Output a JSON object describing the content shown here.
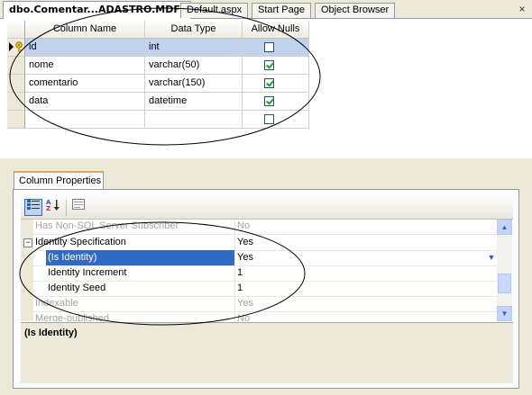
{
  "tabs": [
    {
      "label": "dbo.Comentar...ADASTRO.MDF)",
      "active": true
    },
    {
      "label": "Default.aspx",
      "active": false
    },
    {
      "label": "Start Page",
      "active": false
    },
    {
      "label": "Object Browser",
      "active": false
    }
  ],
  "close_icon": "×",
  "table": {
    "headers": [
      "Column Name",
      "Data Type",
      "Allow Nulls"
    ],
    "rows": [
      {
        "name": "id",
        "type": "int",
        "allow_nulls": false,
        "primary_key": true
      },
      {
        "name": "nome",
        "type": "varchar(50)",
        "allow_nulls": true
      },
      {
        "name": "comentario",
        "type": "varchar(150)",
        "allow_nulls": true
      },
      {
        "name": "data",
        "type": "datetime",
        "allow_nulls": true
      },
      {
        "name": "",
        "type": "",
        "allow_nulls": false
      }
    ]
  },
  "column_properties": {
    "tab_label": "Column Properties",
    "toolbar": {
      "categorized_icon": "categorized-icon",
      "alphabetical_icon": "alphabetical-icon",
      "property_pages_icon": "property-pages-icon"
    },
    "rows": [
      {
        "name": "Has Non-SQL Server Subscriber",
        "value": "No",
        "disabled": true
      },
      {
        "name": "Identity Specification",
        "value": "Yes",
        "expander": "−"
      },
      {
        "name": "(Is Identity)",
        "value": "Yes",
        "selected": true
      },
      {
        "name": "Identity Increment",
        "value": "1"
      },
      {
        "name": "Identity Seed",
        "value": "1"
      },
      {
        "name": "Indexable",
        "value": "Yes",
        "disabled": true
      },
      {
        "name": "Merge-published",
        "value": "No",
        "disabled": true
      }
    ],
    "description_title": "(Is Identity)"
  },
  "colors": {
    "selection": "#316ac5",
    "grid_selected": "#c1d2ee",
    "tab_accent": "#e8a43a"
  }
}
